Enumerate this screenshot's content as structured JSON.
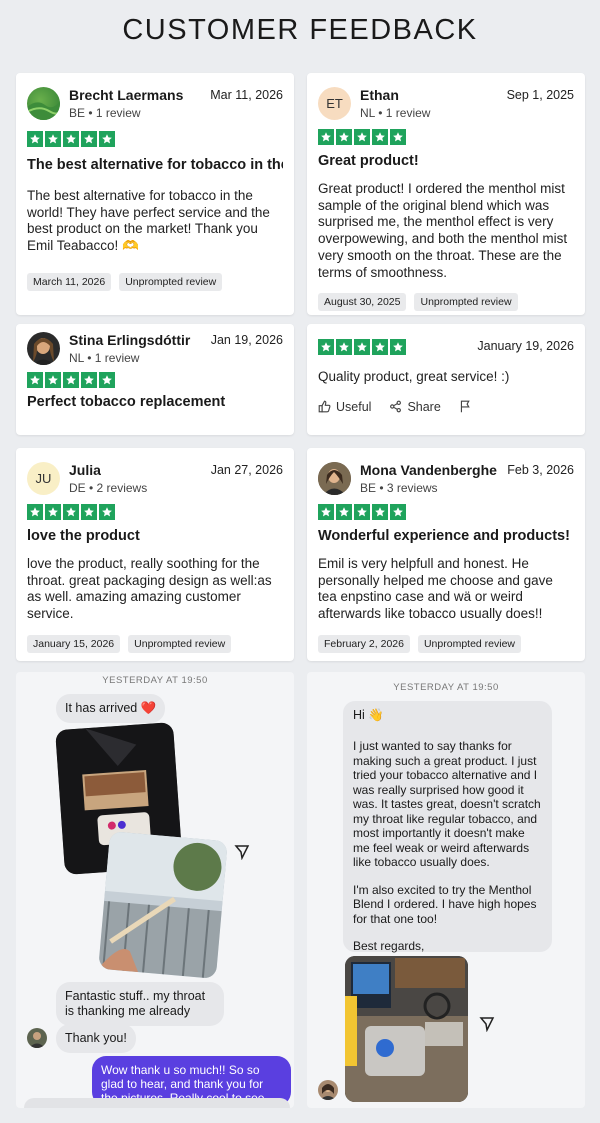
{
  "page": {
    "title": "CUSTOMER FEEDBACK"
  },
  "colors": {
    "star_green": "#1fa35c",
    "chat_accent": "#5a3fe0",
    "background": "#ebedf0"
  },
  "rating": 5,
  "reviews": [
    {
      "name": "Brecht Laermans",
      "meta": "BE • 1 review",
      "date": "Mar 11, 2026",
      "title": "The best alternative for tobacco in the...",
      "body": "The best alternative for tobacco in the world! They have perfect service and the best product on the market! Thank you Emil Teabacco! 🫶",
      "tags": [
        "March 11, 2026",
        "Unprompted review"
      ]
    },
    {
      "name": "Ethan",
      "initials": "ET",
      "meta": "NL • 1 review",
      "date": "Sep 1, 2025",
      "title": "Great product!",
      "body": "Great product! I ordered the menthol mist sample of the original blend which was surprised me, the menthol effect is very overpowewing, and both the menthol mist very smooth on the throat. These are the terms of smoothness.",
      "tags": [
        "August 30, 2025",
        "Unprompted review"
      ]
    },
    {
      "name": "Stina Erlingsdóttir",
      "meta": "NL • 1 review",
      "date": "Jan 19, 2026",
      "title": "Perfect tobacco replacement"
    },
    {
      "date": "January 19, 2026",
      "body": "Quality product, great service! :)",
      "actions": [
        "Useful",
        "Share"
      ]
    },
    {
      "name": "Julia",
      "initials": "JU",
      "meta": "DE • 2 reviews",
      "date": "Jan 27, 2026",
      "title": "love the product",
      "body": "love the product, really soothing for the throat. great packaging design as well:as as well. amazing amazing customer service.",
      "tags": [
        "January 15, 2026",
        "Unprompted review"
      ]
    },
    {
      "name": "Mona Vandenberghe",
      "meta": "BE • 3 reviews",
      "date": "Feb 3, 2026",
      "title": "Wonderful experience and products!",
      "body": "Emil is very helpfull and honest. He personally helped me choose and gave tea enpstino case and wä or weird afterwards like tobacco usually does!!",
      "tags": [
        "February 2, 2026",
        "Unprompted review"
      ]
    }
  ],
  "chats": [
    {
      "time": "YESTERDAY AT 19:50",
      "messages": [
        "It has arrived ❤️",
        "Fantastic stuff.. my throat is thanking me already",
        "Thank you!"
      ],
      "reply": "Wow thank u so much!! So so glad to hear, and thank you for the pictures. Really cool to see the"
    },
    {
      "time": "YESTERDAY AT 19:50",
      "greeting": "Hi 👋",
      "p1": "I just wanted to say thanks for making such a great product. I just tried your tobacco alternative and I was really surprised how good it was. It tastes great, doesn't scratch my throat like regular tobacco, and most importantly it doesn't make me feel weak or weird afterwards like tobacco usually does.",
      "p2": "I'm also excited to try the Menthol Blend I ordered. I have high hopes for that one too!",
      "p3": "Best regards,"
    }
  ]
}
